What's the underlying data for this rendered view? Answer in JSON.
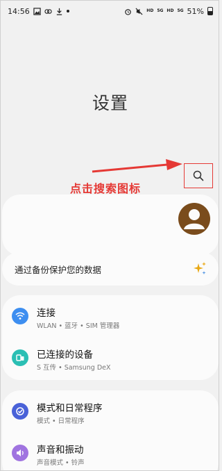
{
  "status_bar": {
    "time": "14:56",
    "battery": "51%",
    "hd1": "HD",
    "hd2": "HD",
    "signal1": "5G",
    "signal2": "5G"
  },
  "page": {
    "title": "设置"
  },
  "annotation": {
    "text": "点击搜索图标",
    "color": "#e53935"
  },
  "search": {
    "icon": "search-icon"
  },
  "profile": {
    "avatar": "avatar-icon"
  },
  "backup": {
    "label": "通过备份保护您的数据",
    "icon": "sparkle-icon"
  },
  "connection_group": [
    {
      "title": "连接",
      "subtitle": "WLAN • 蓝牙 • SIM 管理器",
      "icon": "wifi-icon",
      "color": "#3d8ef0"
    },
    {
      "title": "已连接的设备",
      "subtitle": "S 互传 • Samsung DeX",
      "icon": "devices-icon",
      "color": "#2bbfb4"
    }
  ],
  "mode_group": [
    {
      "title": "模式和日常程序",
      "subtitle": "模式 • 日常程序",
      "icon": "modes-icon",
      "color": "#4a62d8"
    },
    {
      "title": "声音和振动",
      "subtitle": "声音模式 • 铃声",
      "icon": "sound-icon",
      "color": "#a074e0"
    }
  ]
}
